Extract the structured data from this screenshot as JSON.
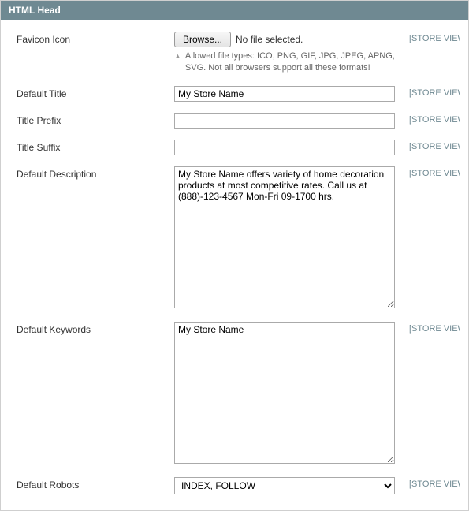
{
  "section": {
    "title": "HTML Head"
  },
  "scope_label": "[STORE VIEW]",
  "fields": {
    "favicon": {
      "label": "Favicon Icon",
      "browse_label": "Browse...",
      "no_file": "No file selected.",
      "note": "Allowed file types: ICO, PNG, GIF, JPG, JPEG, APNG, SVG. Not all browsers support all these formats!"
    },
    "default_title": {
      "label": "Default Title",
      "value": "My Store Name"
    },
    "title_prefix": {
      "label": "Title Prefix",
      "value": ""
    },
    "title_suffix": {
      "label": "Title Suffix",
      "value": ""
    },
    "default_description": {
      "label": "Default Description",
      "value": "My Store Name offers variety of home decoration products at most competitive rates. Call us at (888)-123-4567 Mon-Fri 09-1700 hrs."
    },
    "default_keywords": {
      "label": "Default Keywords",
      "value": "My Store Name"
    },
    "default_robots": {
      "label": "Default Robots",
      "value": "INDEX, FOLLOW"
    }
  }
}
